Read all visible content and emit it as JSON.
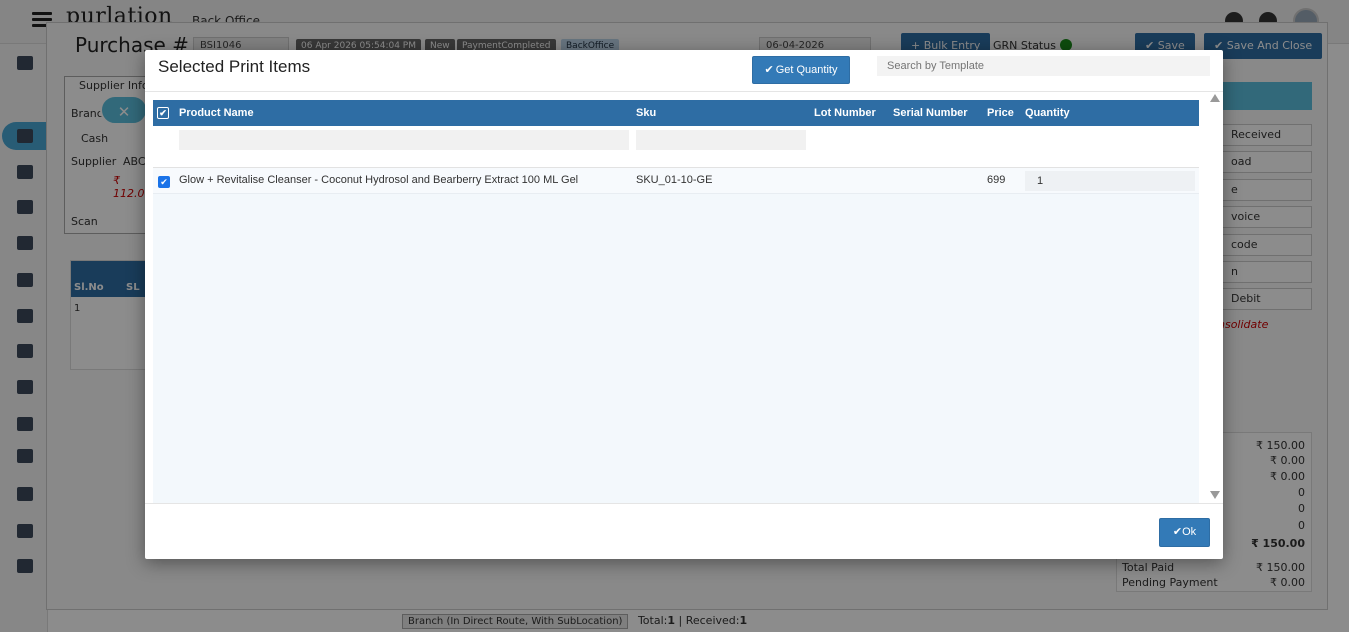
{
  "app": {
    "brand": "purlation",
    "brand_sub": "Back Office",
    "page_title": "Purchase #",
    "purchase_no": "BSI1046",
    "datetime": "06 Apr 2026 05:54:04 PM",
    "status_new": "New",
    "status_payment": "PaymentCompleted",
    "status_source": "BackOffice",
    "date_input": "06-04-2026",
    "bulk_entry": "Bulk Entry",
    "grn_status": "GRN Status",
    "save": "Save",
    "save_close": "Save And Close",
    "supplier_info": "Supplier Info",
    "branch": "Branch",
    "cash": "Cash",
    "supplier": "Supplier",
    "supplier_value": "ABC",
    "amount": "₹ 112.0",
    "scan": "Scan",
    "sl_no": "Sl.No",
    "sl": "SL",
    "row_no": "1",
    "right_items": [
      "Received",
      "oad",
      "e",
      "voice",
      "code",
      "n",
      "Debit"
    ],
    "consolidate": "nsolidate",
    "totals": {
      "lines": [
        "₹ 150.00",
        "₹ 0.00",
        "₹ 0.00",
        "0",
        "0",
        "0",
        "₹ 150.00"
      ],
      "total_paid_label": "Total Paid",
      "total_paid": "₹ 150.00",
      "pending_label": "Pending Payment",
      "pending": "₹ 0.00"
    },
    "bottom_tag": "Branch (In Direct Route, With SubLocation)",
    "bottom_total_label": "Total:",
    "bottom_total": "1",
    "bottom_received_label": "| Received:",
    "bottom_received": "1"
  },
  "modal": {
    "title": "Selected Print Items",
    "get_quantity": "Get Quantity",
    "search_placeholder": "Search by Template",
    "columns": {
      "product_name": "Product Name",
      "sku": "Sku",
      "lot_number": "Lot Number",
      "serial_number": "Serial Number",
      "price": "Price",
      "quantity": "Quantity"
    },
    "rows": [
      {
        "product_name": "Glow + Revitalise Cleanser - Coconut Hydrosol and Bearberry Extract 100 ML Gel",
        "sku": "SKU_01-10-GE",
        "lot_number": "",
        "serial_number": "",
        "price": "699",
        "quantity": "1",
        "checked": true
      }
    ],
    "ok": "Ok"
  },
  "colors": {
    "primary": "#337ab7",
    "header_bg": "#2e6da4",
    "accent": "#5bc0de",
    "grn_ok": "#1a8a1a"
  }
}
